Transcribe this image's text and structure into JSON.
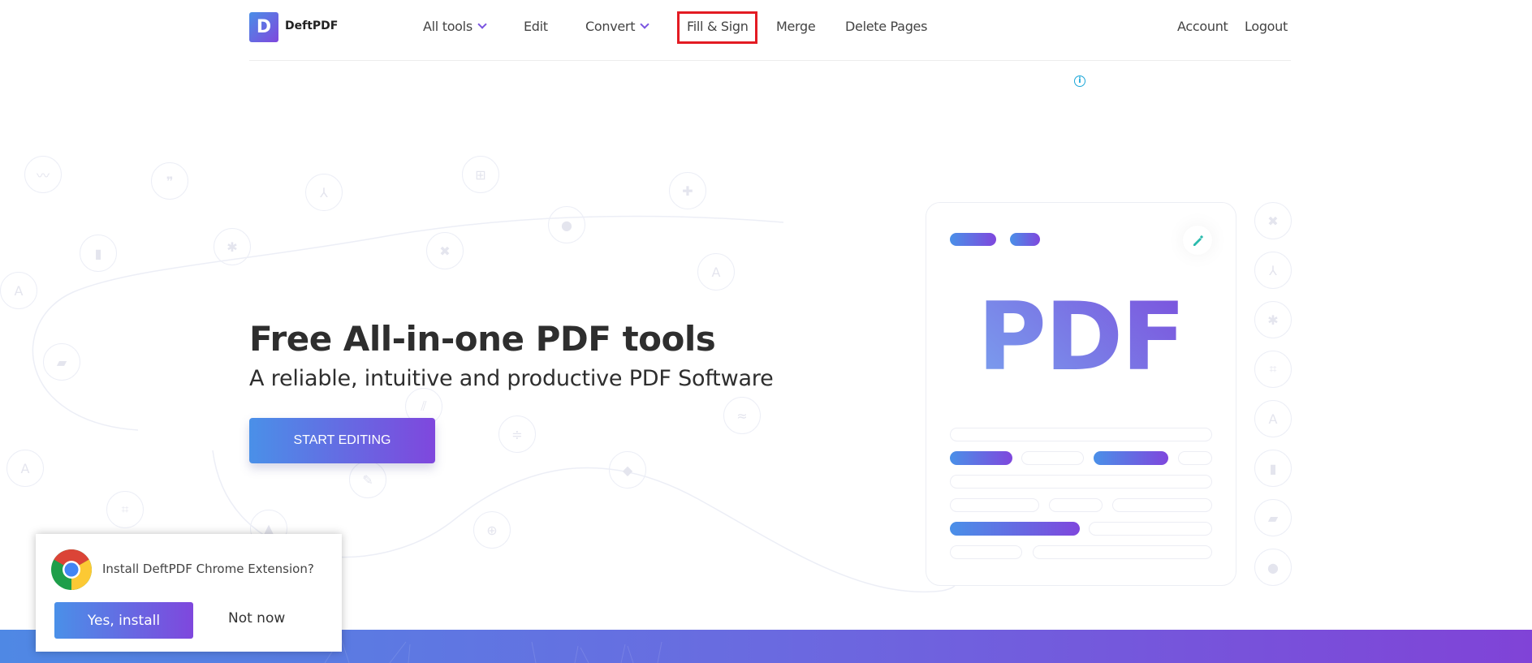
{
  "header": {
    "logo_letter": "D",
    "logo_text": "DeftPDF",
    "nav": [
      {
        "label": "All tools",
        "has_dropdown": true
      },
      {
        "label": "Edit",
        "has_dropdown": false
      },
      {
        "label": "Convert",
        "has_dropdown": true
      },
      {
        "label": "Fill & Sign",
        "has_dropdown": false,
        "highlighted": true
      },
      {
        "label": "Merge",
        "has_dropdown": false
      },
      {
        "label": "Delete Pages",
        "has_dropdown": false
      }
    ],
    "account_label": "Account",
    "logout_label": "Logout",
    "info_icon": "info-icon"
  },
  "hero": {
    "title": "Free All-in-one PDF tools",
    "subtitle": "A reliable, intuitive and productive PDF Software",
    "cta_label": "START EDITING"
  },
  "illustration": {
    "big_text": "PDF",
    "edit_icon": "pencil-icon"
  },
  "decorative_icons": [
    "chart-icon",
    "quote-icon",
    "merge-icon",
    "grid-icon",
    "add-comment-icon",
    "bookmark-icon",
    "puzzle-icon",
    "delete-file-icon",
    "palette-icon",
    "text-select-icon",
    "text-icon",
    "gallery-icon",
    "hatch-icon",
    "sliders-icon",
    "signal-icon",
    "text-icon",
    "crop-icon",
    "pencil-icon",
    "tag-icon",
    "rotate-add-icon",
    "upload-icon"
  ],
  "right_icons": [
    "delete-file-icon",
    "merge-icon",
    "puzzle-icon",
    "crop-icon",
    "text-icon",
    "bookmark-icon",
    "gallery-icon",
    "palette-icon"
  ],
  "popup": {
    "message": "Install DeftPDF Chrome Extension?",
    "confirm_label": "Yes, install",
    "dismiss_label": "Not now"
  },
  "colors": {
    "accent_start": "#4a90e8",
    "accent_end": "#7f47dd",
    "highlight_border": "#e31b23",
    "info": "#1ba7d8",
    "pencil": "#2bbbad"
  }
}
